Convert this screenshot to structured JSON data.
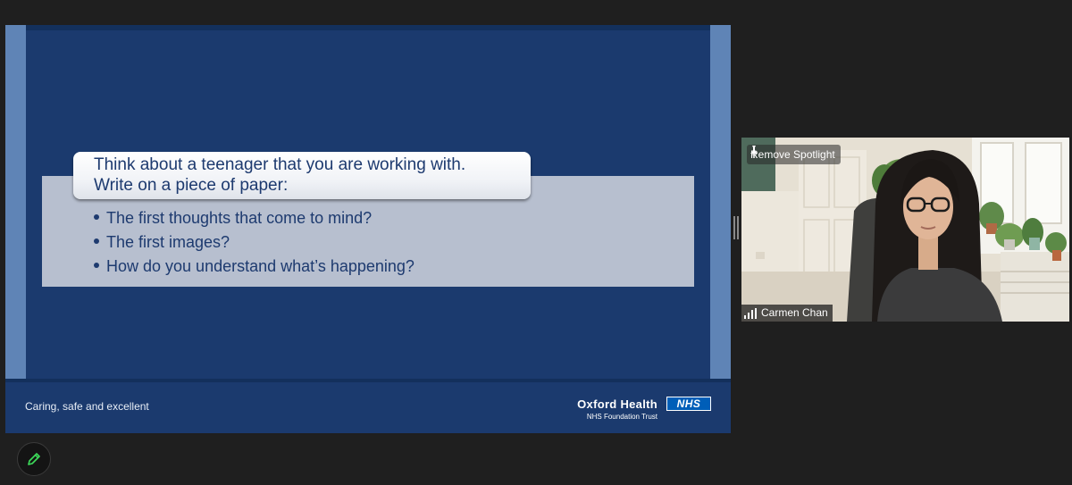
{
  "slide": {
    "title_line1": "Think about a teenager that you are working with.",
    "title_line2": "Write on a piece of paper:",
    "bullets": [
      "The first thoughts that come to mind?",
      "The first images?",
      "How do you understand what’s happening?"
    ],
    "footer_tagline": "Caring, safe and excellent",
    "org_name": "Oxford Health",
    "org_subtitle": "NHS Foundation Trust",
    "nhs_badge": "NHS"
  },
  "video_tile": {
    "spotlight_label": "Remove Spotlight",
    "participant_name": "Carmen Chan",
    "icons": [
      "pin-icon",
      "signal-strength-icon"
    ]
  },
  "toolbar": {
    "annotate_icon": "pencil-icon"
  },
  "colors": {
    "slide_bg": "#1b3a6e",
    "slide_side": "#5f84b6",
    "content_band": "#b7bfcf",
    "slide_text": "#1d3a6f",
    "nhs_blue": "#005eb8",
    "app_bg": "#1f1f1f",
    "annotate_green": "#3ddc5a"
  }
}
